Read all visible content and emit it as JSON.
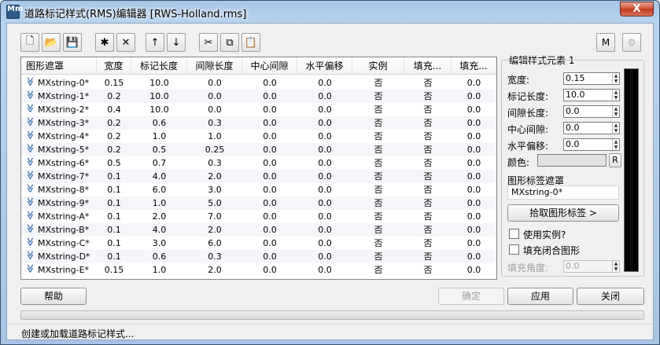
{
  "window": {
    "title": "道路标记样式(RMS)编辑器 [RWS-Holland.rms]",
    "icon_text": "Mm",
    "close_symbol": "X"
  },
  "toolbar": {
    "buttons": [
      {
        "name": "new-file-button",
        "glyph": "🗋",
        "enabled": true
      },
      {
        "name": "open-file-button",
        "glyph": "📂",
        "enabled": true
      },
      {
        "name": "save-file-button",
        "glyph": "💾",
        "enabled": true
      },
      {
        "name": "new-style-button",
        "glyph": "✱",
        "enabled": true
      },
      {
        "name": "delete-style-button",
        "glyph": "✕",
        "enabled": true
      },
      {
        "name": "move-up-button",
        "glyph": "↑",
        "enabled": true
      },
      {
        "name": "move-down-button",
        "glyph": "↓",
        "enabled": true
      },
      {
        "name": "cut-button",
        "glyph": "✂",
        "enabled": true
      },
      {
        "name": "copy-button",
        "glyph": "⧉",
        "enabled": true
      },
      {
        "name": "paste-button",
        "glyph": "📋",
        "enabled": false
      }
    ],
    "right_m_label": "M"
  },
  "table": {
    "headers": [
      "图形遮罩",
      "宽度",
      "标记长度",
      "间隙长度",
      "中心间隙",
      "水平偏移",
      "实例",
      "填充...",
      "填充..."
    ],
    "rows": [
      [
        "MXstring-0*",
        "0.15",
        "10.0",
        "0.0",
        "0.0",
        "0.0",
        "否",
        "否",
        "0.0"
      ],
      [
        "MXstring-1*",
        "0.2",
        "10.0",
        "0.0",
        "0.0",
        "0.0",
        "否",
        "否",
        "0.0"
      ],
      [
        "MXstring-2*",
        "0.4",
        "10.0",
        "0.0",
        "0.0",
        "0.0",
        "否",
        "否",
        "0.0"
      ],
      [
        "MXstring-3*",
        "0.2",
        "0.6",
        "0.3",
        "0.0",
        "0.0",
        "否",
        "否",
        "0.0"
      ],
      [
        "MXstring-4*",
        "0.2",
        "1.0",
        "1.0",
        "0.0",
        "0.0",
        "否",
        "否",
        "0.0"
      ],
      [
        "MXstring-5*",
        "0.2",
        "0.5",
        "0.25",
        "0.0",
        "0.0",
        "否",
        "否",
        "0.0"
      ],
      [
        "MXstring-6*",
        "0.5",
        "0.7",
        "0.3",
        "0.0",
        "0.0",
        "否",
        "否",
        "0.0"
      ],
      [
        "MXstring-7*",
        "0.1",
        "4.0",
        "2.0",
        "0.0",
        "0.0",
        "否",
        "否",
        "0.0"
      ],
      [
        "MXstring-8*",
        "0.1",
        "6.0",
        "3.0",
        "0.0",
        "0.0",
        "否",
        "否",
        "0.0"
      ],
      [
        "MXstring-9*",
        "0.1",
        "1.0",
        "5.0",
        "0.0",
        "0.0",
        "否",
        "否",
        "0.0"
      ],
      [
        "MXstring-A*",
        "0.1",
        "2.0",
        "7.0",
        "0.0",
        "0.0",
        "否",
        "否",
        "0.0"
      ],
      [
        "MXstring-B*",
        "0.1",
        "4.0",
        "2.0",
        "0.0",
        "0.0",
        "否",
        "否",
        "0.0"
      ],
      [
        "MXstring-C*",
        "0.1",
        "3.0",
        "6.0",
        "0.0",
        "0.0",
        "否",
        "否",
        "0.0"
      ],
      [
        "MXstring-D*",
        "0.1",
        "0.6",
        "0.3",
        "0.0",
        "0.0",
        "否",
        "否",
        "0.0"
      ],
      [
        "MXstring-E*",
        "0.15",
        "1.0",
        "2.0",
        "0.0",
        "0.0",
        "否",
        "否",
        "0.0"
      ]
    ]
  },
  "editor": {
    "group_title": "编辑样式元素 1",
    "width_label": "宽度:",
    "width_value": "0.15",
    "mark_length_label": "标记长度:",
    "mark_length_value": "10.0",
    "gap_length_label": "间隙长度:",
    "gap_length_value": "0.0",
    "center_gap_label": "中心间隙:",
    "center_gap_value": "0.0",
    "h_offset_label": "水平偏移:",
    "h_offset_value": "0.0",
    "color_label": "颜色:",
    "color_reset_label": "R",
    "shape_mask_label": "图形标签遮罩",
    "shape_mask_value": "MXstring-0*",
    "pick_shape_label": "拾取图形标签 >",
    "use_instance_label": "使用实例?",
    "fill_closed_label": "填充闭合图形",
    "fill_angle_label": "填充角度:",
    "fill_angle_value": "0.0"
  },
  "buttons": {
    "help": "帮助",
    "ok": "确定",
    "apply": "应用",
    "close": "关闭"
  },
  "status": {
    "text": "创建或加载道路标记样式..."
  }
}
